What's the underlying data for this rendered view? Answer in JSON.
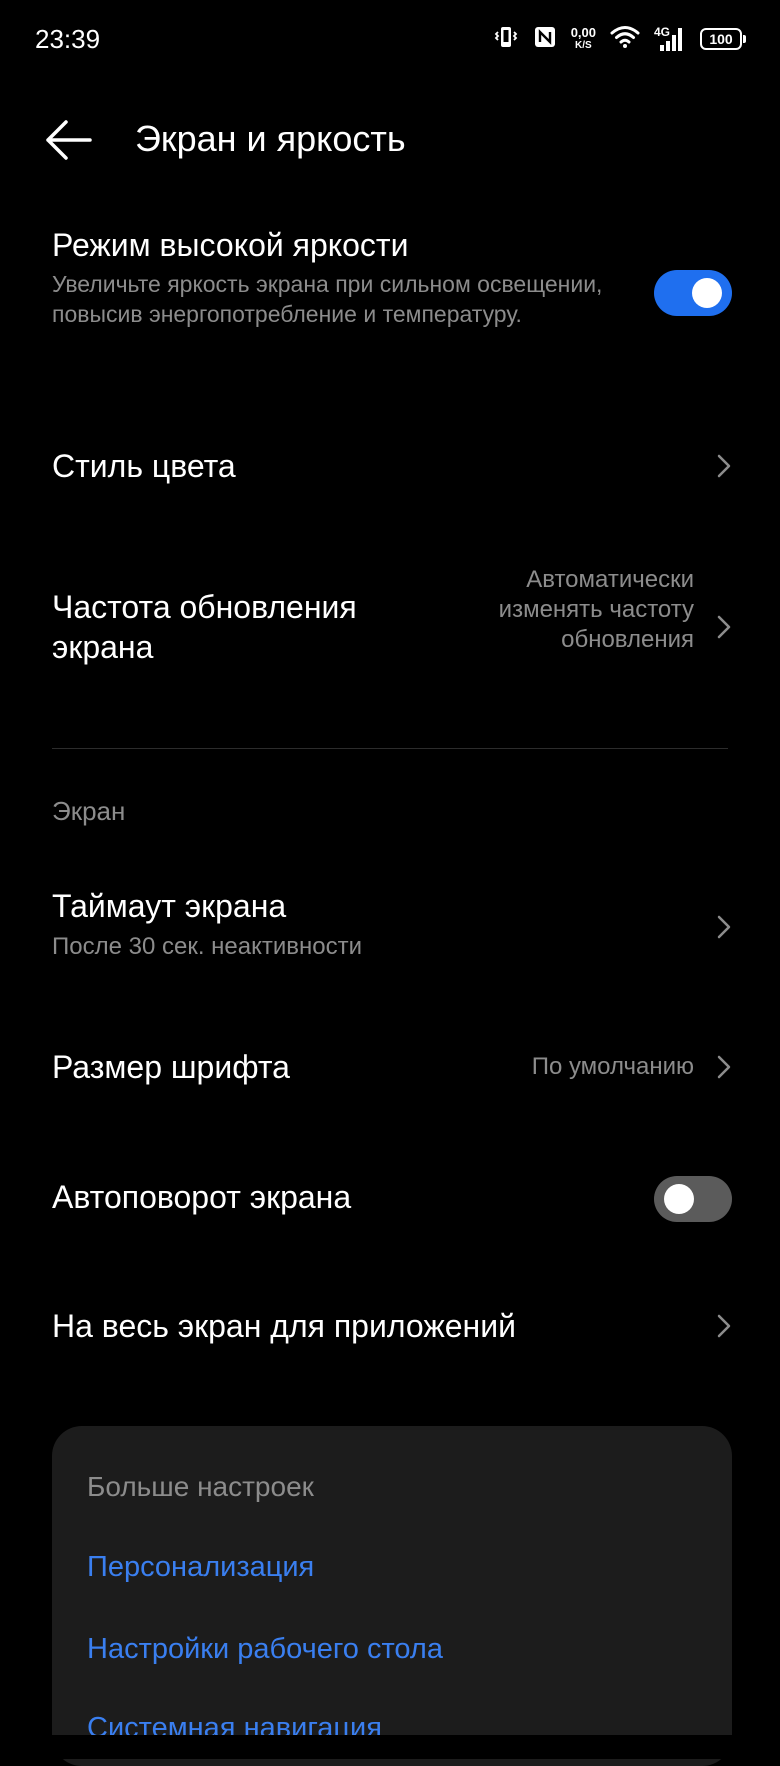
{
  "status_bar": {
    "time": "23:39",
    "net_speed_value": "0,00",
    "net_speed_unit": "K/S",
    "network_type": "4G",
    "battery": "100",
    "icons": [
      "vibrate-icon",
      "nfc-icon",
      "wifi-icon",
      "signal-icon",
      "battery-icon"
    ]
  },
  "header": {
    "title": "Экран и яркость"
  },
  "settings": {
    "high_brightness": {
      "title": "Режим высокой яркости",
      "subtitle": "Увеличьте яркость экрана при сильном освещении, повысив энергопотребление и температуру.",
      "enabled": true
    },
    "color_style": {
      "title": "Стиль цвета"
    },
    "refresh_rate": {
      "title": "Частота обновления экрана",
      "value": "Автоматически изменять частоту обновления"
    },
    "section_screen": "Экран",
    "screen_timeout": {
      "title": "Таймаут экрана",
      "subtitle": "После 30 сек. неактивности"
    },
    "font_size": {
      "title": "Размер шрифта",
      "value": "По умолчанию"
    },
    "auto_rotate": {
      "title": "Автоповорот экрана",
      "enabled": false
    },
    "fullscreen_apps": {
      "title": "На весь экран для приложений"
    }
  },
  "more_settings": {
    "title": "Больше настроек",
    "links": [
      "Персонализация",
      "Настройки рабочего стола",
      "Системная навигация"
    ]
  },
  "colors": {
    "background": "#000000",
    "accent": "#1f6fef",
    "link": "#3a7ff0",
    "secondary_text": "#8c8c8c",
    "card": "#1c1c1c"
  }
}
